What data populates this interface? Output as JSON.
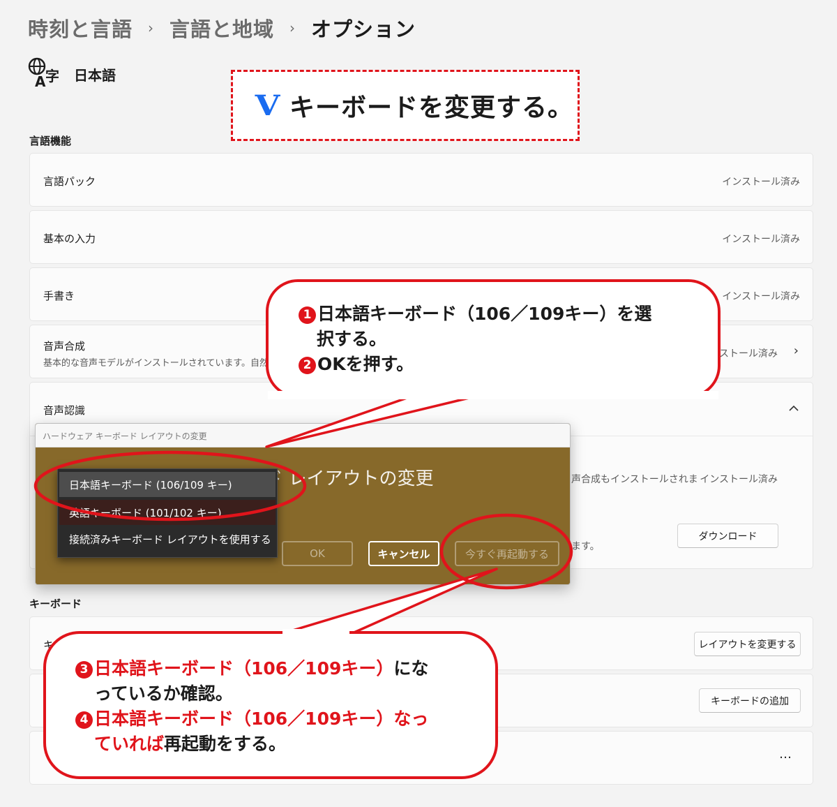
{
  "breadcrumb": {
    "item1": "時刻と言語",
    "item2": "言語と地域",
    "current": "オプション",
    "separator": "›"
  },
  "language": {
    "name": "日本語",
    "icon": "language-icon"
  },
  "banner": {
    "mark": "V",
    "text": "キーボードを変更する。",
    "accent": "#e0141b",
    "mark_color": "#1a6cf0"
  },
  "sections": {
    "language_features": "言語機能",
    "keyboard": "キーボード"
  },
  "rows": [
    {
      "title": "言語パック",
      "status": "インストール済み"
    },
    {
      "title": "基本の入力",
      "status": "インストール済み"
    },
    {
      "title": "手書き",
      "status": "インストール済み"
    },
    {
      "title": "音声合成",
      "desc": "基本的な音声モデルがインストールされています。自然",
      "status": "ンストール済み"
    },
    {
      "title": "音声認識"
    }
  ],
  "speech_recog": {
    "desc_visible": "声合成もインストールされま",
    "status": "インストール済み",
    "desc2_visible": "ます。",
    "download_button": "ダウンロード"
  },
  "keyboard_rows": {
    "row1_visible": "キ",
    "layout_button": "レイアウトを変更する",
    "add_keyboard_button": "キーボードの追加",
    "more_icon": "…"
  },
  "dialog": {
    "title": "ハードウェア キーボード レイアウトの変更",
    "heading": "ハードウェア キーボード レイアウトの変更",
    "options": [
      "日本語キーボード (106/109 キー)",
      "英語キーボード (101/102 キー)",
      "接続済みキーボード レイアウトを使用する"
    ],
    "ok": "OK",
    "cancel": "キャンセル",
    "restart": "今すぐ再起動する",
    "bg_color": "#87692a"
  },
  "callout_top": {
    "n1": "1",
    "line1": "日本語キーボード（106／109キー）を選",
    "line1b": "択する。",
    "n2": "2",
    "line2": "OKを押す。"
  },
  "callout_bottom": {
    "n3": "3",
    "line3_red": "日本語キーボード（106／109キー）",
    "line3_black": "にな",
    "line3b": "っているか確認。",
    "n4": "4",
    "line4_red": "日本語キーボード（106／109キー）なっ",
    "line4b_red": "ていれば",
    "line4b_bold": "再起動",
    "line4b_tail": "をする。"
  }
}
